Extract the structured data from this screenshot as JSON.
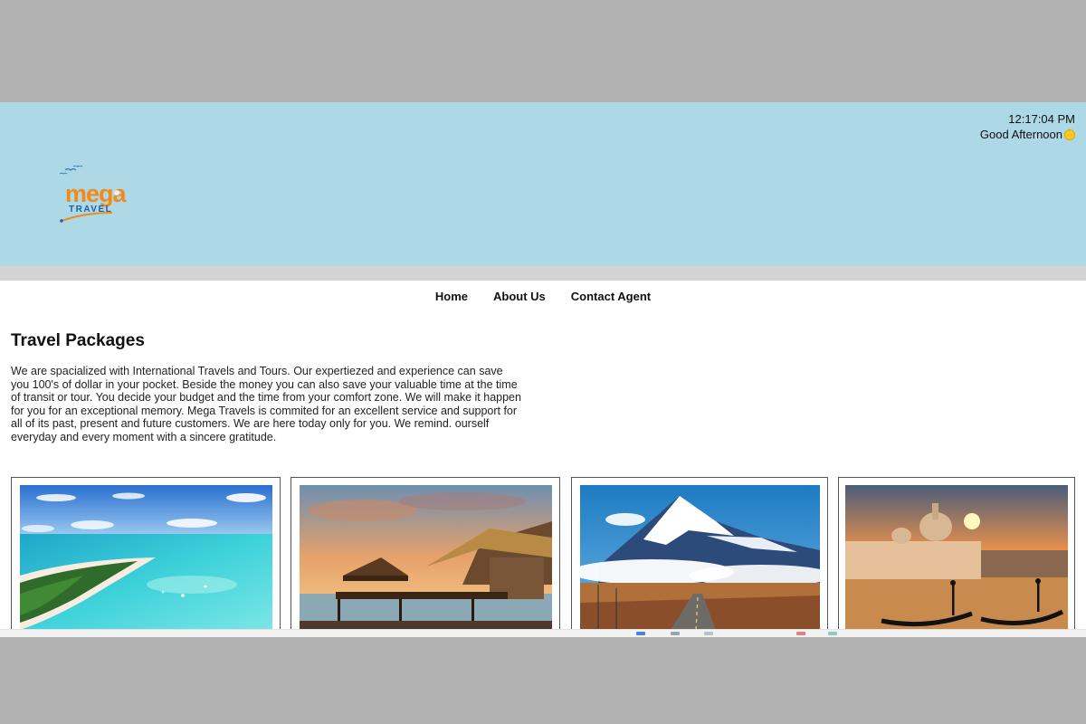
{
  "clock": {
    "time": "12:17:04 PM",
    "greeting": "Good Afternoon"
  },
  "logo": {
    "alt": "Mega Travel logo"
  },
  "nav": {
    "items": [
      "Home",
      "About Us",
      "Contact Agent"
    ]
  },
  "main": {
    "title": "Travel Packages",
    "intro": "We are spacialized with International Travels and Tours. Our expertiezed and experience can save you 100's of dollar in your pocket. Beside the money you can also save your valuable time at the time of transit or tour. You decide your budget and the time from your comfort zone. We will make it happen for you for an exceptional memory. Mega Travels is commited for an excellent service and support for all of its past, present and future customers. We are here today only for you. We remind. ourself everyday and every moment with a sincere gratitude."
  },
  "packages": [
    {
      "image": "tropical-island-photo"
    },
    {
      "image": "beach-hut-sunset-photo"
    },
    {
      "image": "snowy-mountain-road-photo"
    },
    {
      "image": "venice-canal-sunset-photo"
    }
  ],
  "colors": {
    "header_bg": "#add8e6",
    "band": "#d3d3d3",
    "accent_orange": "#f28a1b",
    "logo_blue": "#1f5fa8"
  }
}
